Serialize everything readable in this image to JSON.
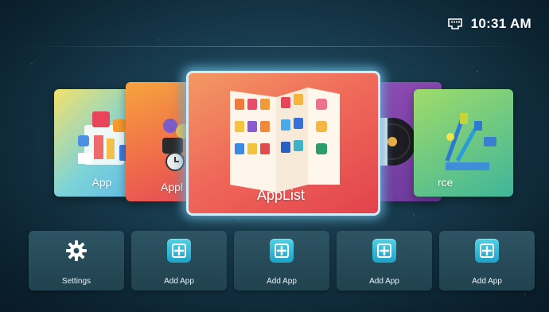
{
  "status": {
    "clock": "10:31 AM",
    "network_icon": "ethernet-icon"
  },
  "carousel": {
    "cards": [
      {
        "label": "App",
        "icon": "app-store-icon"
      },
      {
        "label": "Appl",
        "icon": "apps-icon"
      },
      {
        "label": "AppList",
        "icon": "applist-book-icon"
      },
      {
        "label": "",
        "icon": "media-disc-icon"
      },
      {
        "label": "rce",
        "icon": "source-cables-icon"
      }
    ]
  },
  "tiles": [
    {
      "label": "Settings",
      "icon": "gear-icon"
    },
    {
      "label": "Add App",
      "icon": "add-app-icon"
    },
    {
      "label": "Add App",
      "icon": "add-app-icon"
    },
    {
      "label": "Add App",
      "icon": "add-app-icon"
    },
    {
      "label": "Add App",
      "icon": "add-app-icon"
    }
  ],
  "colors": {
    "focus_glow": "#cfefff",
    "tile_bg": "#2a4d5b",
    "add_icon": "#35bcd8"
  }
}
